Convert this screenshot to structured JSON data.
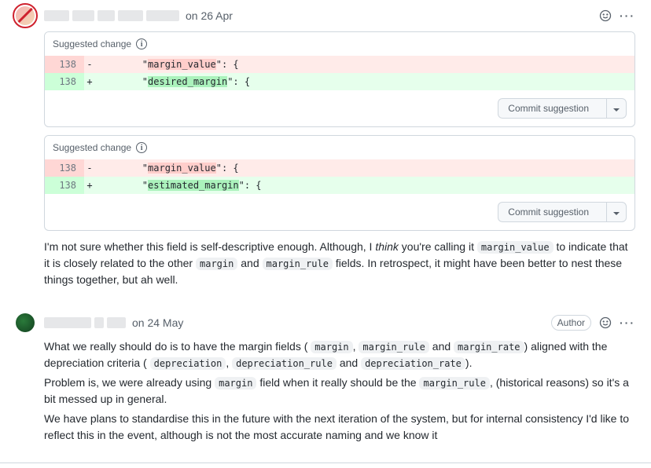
{
  "comments": [
    {
      "author_redact_widths": [
        32,
        28,
        22,
        32,
        42
      ],
      "timestamp": "on 26 Apr",
      "author_badge": null,
      "suggestions": [
        {
          "label": "Suggested change",
          "line": "138",
          "removed_token": "margin_value",
          "added_token": "desired_margin",
          "commit_label": "Commit suggestion"
        },
        {
          "label": "Suggested change",
          "line": "138",
          "removed_token": "margin_value",
          "added_token": "estimated_margin",
          "commit_label": "Commit suggestion"
        }
      ],
      "body": {
        "p1_a": "I'm not sure whether this field is self-descriptive enough. Although, I ",
        "p1_think": "think",
        "p1_b": " you're calling it ",
        "c1": "margin_value",
        "p1_c": " to indicate that it is closely related to the other ",
        "c2": "margin",
        "p1_d": " and ",
        "c3": "margin_rule",
        "p1_e": " fields. In retrospect, it might have been better to nest these things together, but ah well."
      }
    },
    {
      "author_redact_widths": [
        60,
        12,
        24
      ],
      "timestamp": "on 24 May",
      "author_badge": "Author",
      "body": {
        "p1_a": "What we really should do is to have the margin fields (",
        "c1": "margin",
        "s1": ", ",
        "c2": "margin_rule",
        "s2": " and ",
        "c3": "margin_rate",
        "p1_b": ") aligned with the depreciation criteria (",
        "c4": "depreciation",
        "s3": ", ",
        "c5": "depreciation_rule",
        "s4": " and ",
        "c6": "depreciation_rate",
        "p1_c": ").",
        "p2_a": "Problem is, we were already using ",
        "c7": "margin",
        "p2_b": " field when it really should be the ",
        "c8": "margin_rule",
        "p2_c": ", (historical reasons) so it's a bit messed up in general.",
        "p3": "We have plans to standardise this in the future with the next iteration of the system, but for internal consistency I'd like to reflect this in the event, although is not the most accurate naming and we know it"
      }
    }
  ]
}
